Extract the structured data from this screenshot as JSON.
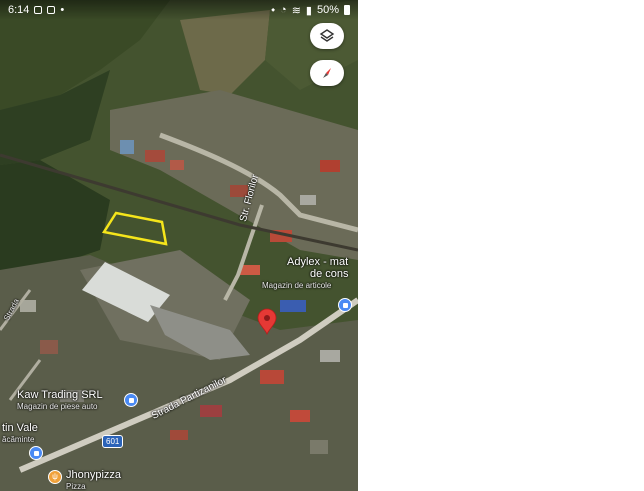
{
  "status_bar": {
    "time": "6:14",
    "battery": "50%"
  },
  "map": {
    "layers_button": "layers-icon",
    "compass_button": "compass-icon",
    "labels": {
      "street_1": "Str. Florilor",
      "street_2": "Strada Partizanilor",
      "street_left": "Strada",
      "route": "601",
      "poi_adylex_name_1": "Adylex - mat",
      "poi_adylex_name_2": "de cons",
      "poi_adylex_sub": "Magazin de articole",
      "poi_kaw_name": "Kaw Trading SRL",
      "poi_kaw_sub": "Magazin de piese auto",
      "poi_vale_name": "tin Vale",
      "poi_vale_sub": "ăcăminte",
      "poi_jhony_name": "Jhonypizza",
      "poi_jhony_sub": "Pizza"
    }
  },
  "colors": {
    "pin": "#e53935",
    "highlight": "#f5e51b",
    "poi_blue": "#4a8af4",
    "poi_orange": "#f0a13a"
  }
}
